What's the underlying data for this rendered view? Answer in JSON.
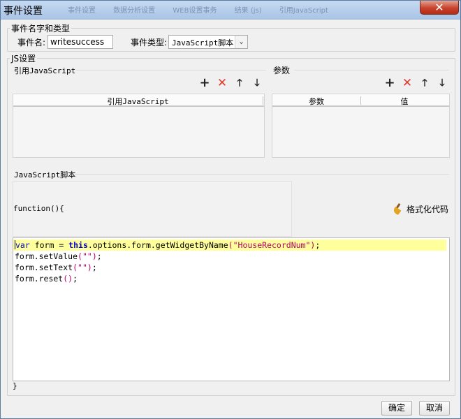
{
  "window": {
    "title": "事件设置",
    "close_glyph": "✕",
    "background_tabs": [
      "事件设置",
      "数据分析设置",
      "WEB设置事务",
      "结果 (js)",
      "引用JavaScript"
    ]
  },
  "event_group": {
    "legend": "事件名字和类型",
    "name_label": "事件名:",
    "name_value": "writesuccess",
    "type_label": "事件类型:",
    "type_value": "JavaScript脚本"
  },
  "js_group": {
    "legend": "JS设置",
    "ref_section": {
      "label": "引用JavaScript",
      "columns": [
        "引用JavaScript"
      ],
      "rows": []
    },
    "param_section": {
      "label": "参数",
      "columns": [
        "参数",
        "值"
      ],
      "rows": []
    },
    "toolbar": {
      "add": "+",
      "delete": "✕",
      "up": "🡑",
      "down": "🡓"
    },
    "script_section": {
      "label": "JavaScript脚本",
      "function_header": "function(){",
      "function_footer": "}",
      "format_button": "格式化代码",
      "code_lines": [
        "var form = this.options.form.getWidgetByName(\"HouseRecordNum\");",
        "form.setValue(\"\");",
        "form.setText(\"\");",
        "form.reset();"
      ]
    }
  },
  "footer": {
    "ok_label": "确定",
    "cancel_label": "取消"
  },
  "colors": {
    "active_line": "#ffff9c",
    "keyword": "#0000cc",
    "string": "#b5006f",
    "delete_icon": "#e03a2c"
  }
}
